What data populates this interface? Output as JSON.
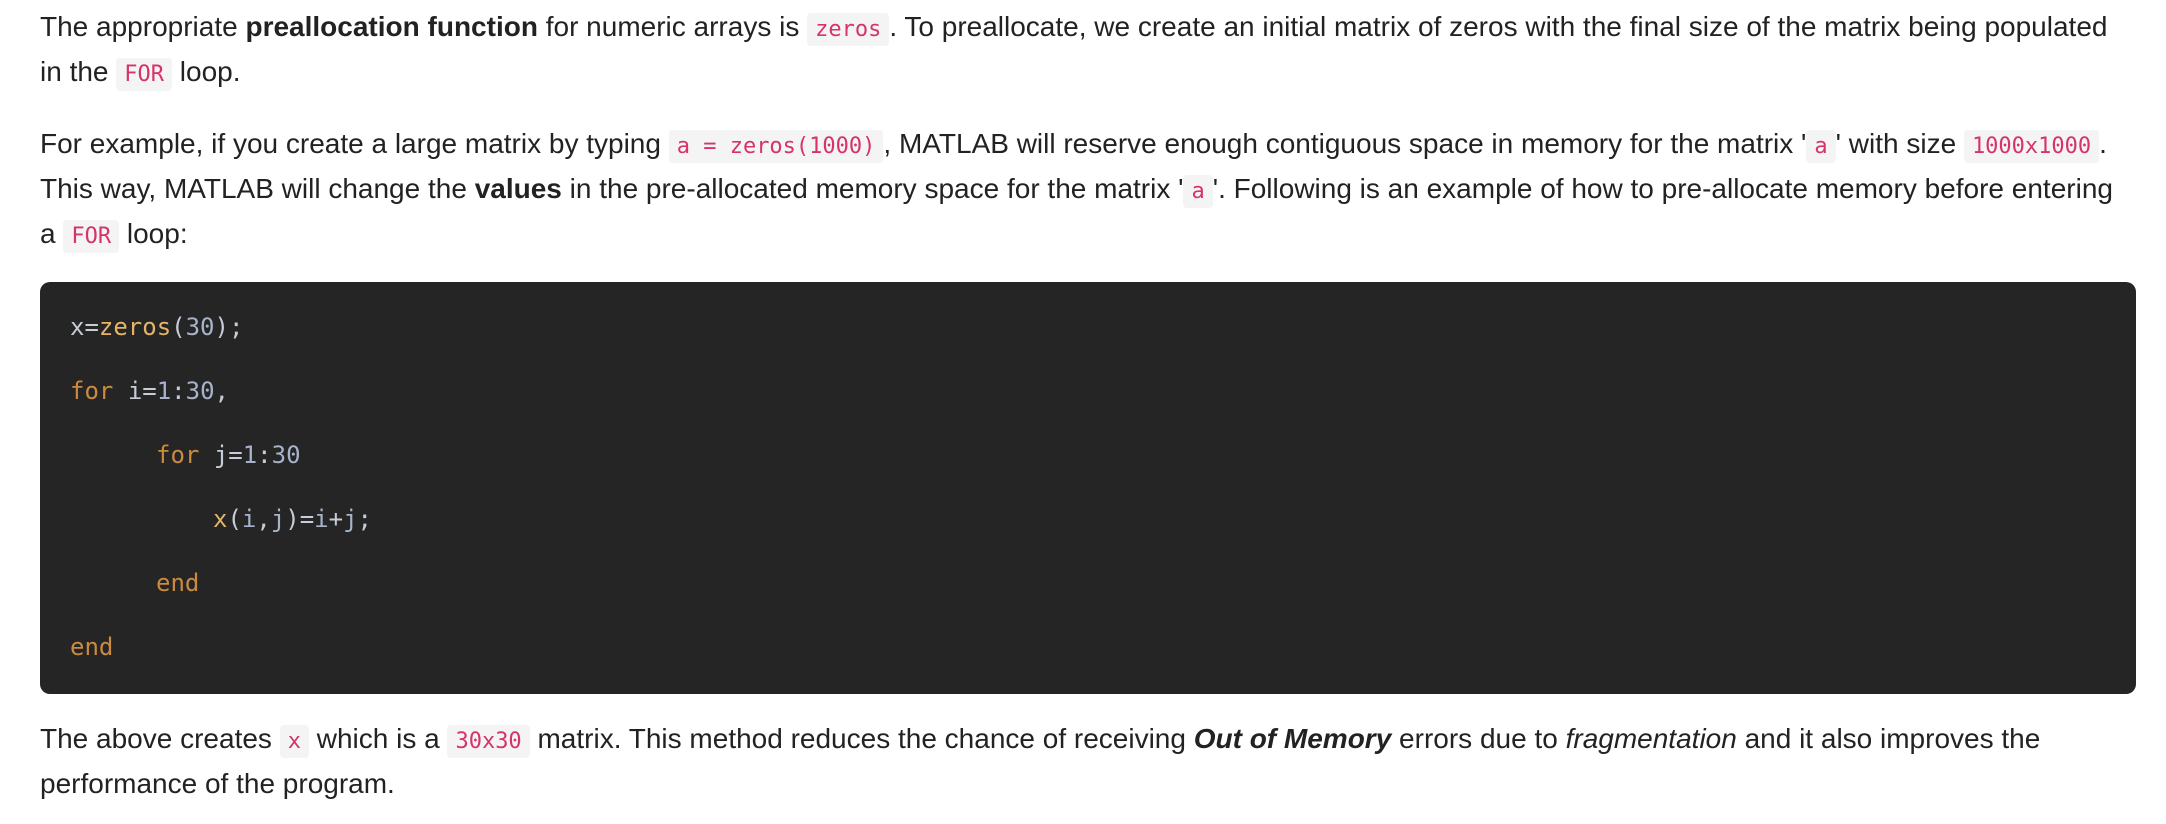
{
  "p1": {
    "t1": "The appropriate ",
    "b1": "preallocation function",
    "t2": " for numeric arrays is ",
    "c1": "zeros",
    "t3": ". To preallocate, we create an initial matrix of zeros with the final size of the matrix being populated in the ",
    "c2": "FOR",
    "t4": " loop."
  },
  "p2": {
    "t1": "For example, if you create a large matrix by typing ",
    "c1": "a = zeros(1000)",
    "t2": ", MATLAB will reserve enough contiguous space in memory for the matrix '",
    "c2": "a",
    "t3": "' with size ",
    "c3": "1000x1000",
    "t4": ". This way, MATLAB will change the ",
    "b1": "values",
    "t5": " in the pre-allocated memory space for the matrix '",
    "c4": "a",
    "t6": "'. Following is an example of how to pre-allocate memory before entering a ",
    "c5": "FOR",
    "t7": " loop:"
  },
  "code": {
    "l1": {
      "var": "x",
      "eq": "=",
      "fn": "zeros",
      "open": "(",
      "num": "30",
      "close": ");"
    },
    "l2": {
      "kw": "for",
      "sp": " ",
      "var": "i",
      "eq": "=",
      "n1": "1",
      "colon": ":",
      "n2": "30",
      "comma": ","
    },
    "l3": {
      "kw": "for",
      "sp": " ",
      "var": "j",
      "eq": "=",
      "n1": "1",
      "colon": ":",
      "n2": "30"
    },
    "l4": {
      "x": "x",
      "open": "(",
      "i": "i",
      "comma": ",",
      "j": "j",
      "close": ")",
      "eq": "=",
      "i2": "i",
      "plus": "+",
      "j2": "j",
      "semi": ";"
    },
    "l5": {
      "kw": "end"
    },
    "l6": {
      "kw": "end"
    }
  },
  "p3": {
    "t1": "The above creates ",
    "c1": "x",
    "t2": " which is a ",
    "c2": "30x30",
    "t3": " matrix. This method reduces the chance of receiving ",
    "bi1": "Out of Memory",
    "t4": " errors due to ",
    "i1": "fragmentation",
    "t5": " and it also improves the performance of the program."
  }
}
